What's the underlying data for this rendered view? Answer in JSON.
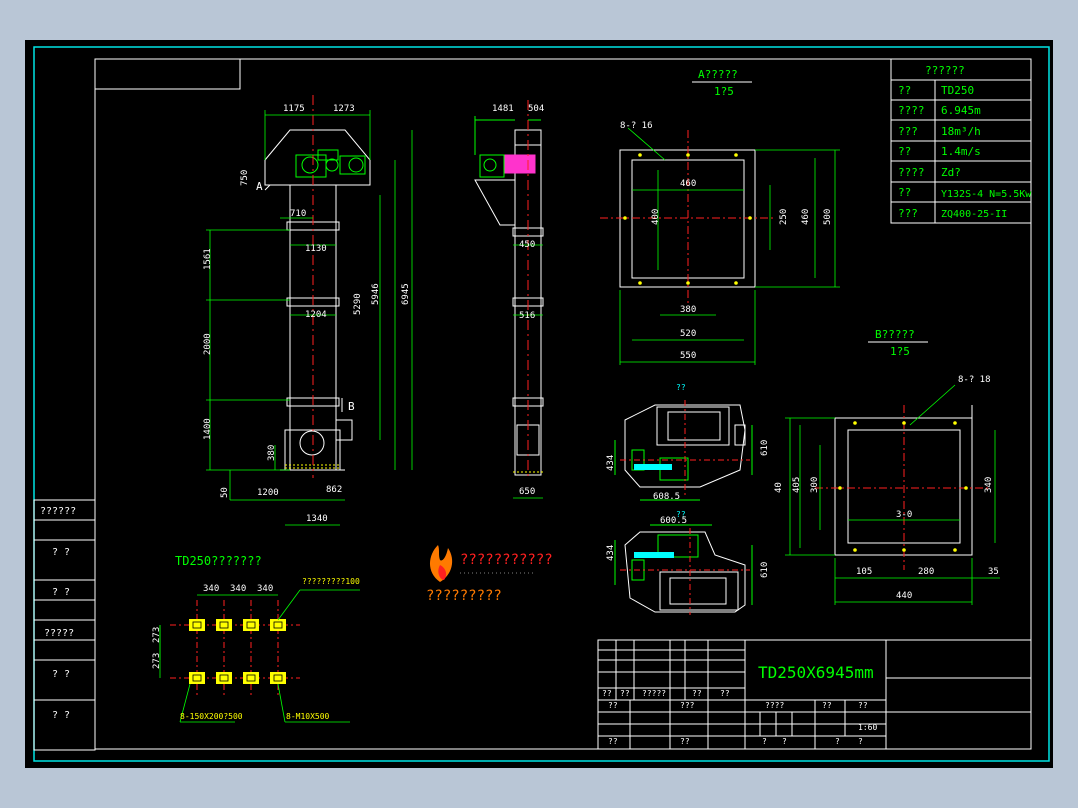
{
  "colors": {
    "app_bg": "#b9c6d6",
    "paper": "#000000",
    "frame": "#00e5e5",
    "white": "#ffffff",
    "green": "#00ff00",
    "yellow": "#ffff00",
    "red": "#ff2020",
    "cyan": "#00e5e5",
    "magenta": "#ff33cc",
    "orange": "#ff7a00"
  },
  "elevation": {
    "dims_top": [
      "1175",
      "1273"
    ],
    "dims_left_misc": [
      "750",
      "710",
      "1130",
      "1204"
    ],
    "dims_left_vertical": [
      "1561",
      "2000",
      "1400",
      "380",
      "50"
    ],
    "dims_bottom": [
      "1200",
      "862",
      "1340"
    ],
    "dims_right_vertical": [
      "5290",
      "5946",
      "6945"
    ],
    "label_a": "A",
    "label_b": "B"
  },
  "side_view": {
    "dims": [
      "1481",
      "504",
      "450",
      "516",
      "650"
    ]
  },
  "view_a": {
    "title": "A?????",
    "scale": "1?5",
    "hole_note": "8-? 16",
    "dims": [
      "460",
      "400",
      "250",
      "460",
      "500",
      "380",
      "520",
      "550"
    ]
  },
  "view_b": {
    "title": "B?????",
    "scale": "1?5",
    "hole_note": "8-? 18",
    "dims": [
      "40",
      "405",
      "300",
      "340",
      "3-0",
      "105",
      "280",
      "35",
      "440"
    ]
  },
  "plan_views": {
    "top_label": "??",
    "bottom_label": "??",
    "dims_top": [
      "434",
      "610",
      "608.5"
    ],
    "dims_bottom": [
      "600.5",
      "434",
      "610"
    ]
  },
  "foundation": {
    "title": "TD250???????",
    "dims_h": [
      "340",
      "340",
      "340"
    ],
    "dims_v": [
      "273",
      "273"
    ],
    "note_top": "?????????100",
    "note_bottom_left": "8-150X200?500",
    "note_bottom_right": "8-M10X500"
  },
  "logo": {
    "text": "???????????",
    "caption": "?????????"
  },
  "spec_table": {
    "title": "??????",
    "rows": [
      {
        "name": "??",
        "value": "TD250"
      },
      {
        "name": "????",
        "value": "6.945m"
      },
      {
        "name": "???",
        "value": "18m³/h"
      },
      {
        "name": "??",
        "value": "1.4m/s"
      },
      {
        "name": "????",
        "value": "Zd?"
      },
      {
        "name": "??",
        "value": "Y132S-4  N=5.5Kw"
      },
      {
        "name": "???",
        "value": "ZQ400-25-II"
      }
    ]
  },
  "left_margin": {
    "items": [
      "??????",
      "? ?",
      "? ?",
      "?????",
      "? ?",
      "? ?"
    ]
  },
  "title_block": {
    "drawing_title": "TD250X6945mm",
    "header_cells": [
      "??",
      "??",
      "?????",
      "??",
      "??"
    ],
    "row2": [
      "??",
      "???"
    ],
    "row3": [
      "??",
      "??"
    ],
    "right_cells": [
      "????",
      "??",
      "??"
    ],
    "scale": "1:60",
    "bottom_cells": [
      "?",
      "?",
      "?",
      "?"
    ]
  }
}
